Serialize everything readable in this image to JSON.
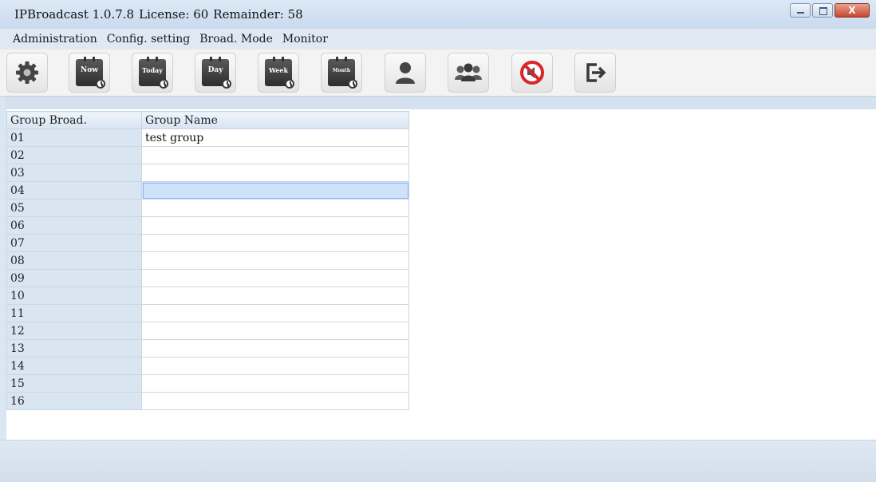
{
  "window": {
    "title_app": "IPBroadcast 1.0.7.8",
    "title_license": "License: 60",
    "title_remainder": "Remainder: 58",
    "close_label": "X"
  },
  "menu": [
    "Administration",
    "Config. setting",
    "Broad. Mode",
    "Monitor"
  ],
  "toolbar": {
    "buttons": [
      {
        "icon": "gear-icon"
      },
      {
        "icon": "calendar-now-icon",
        "label": "Now"
      },
      {
        "icon": "calendar-today-icon",
        "label": "Today"
      },
      {
        "icon": "calendar-day-icon",
        "label": "Day"
      },
      {
        "icon": "calendar-week-icon",
        "label": "Week"
      },
      {
        "icon": "calendar-month-icon",
        "label": "Month"
      },
      {
        "icon": "user-icon"
      },
      {
        "icon": "group-icon"
      },
      {
        "icon": "mute-icon"
      },
      {
        "icon": "exit-icon"
      }
    ]
  },
  "table": {
    "headers": [
      "Group Broad.",
      "Group Name"
    ],
    "rows": [
      {
        "num": "01",
        "name": "test group"
      },
      {
        "num": "02",
        "name": ""
      },
      {
        "num": "03",
        "name": ""
      },
      {
        "num": "04",
        "name": ""
      },
      {
        "num": "05",
        "name": ""
      },
      {
        "num": "06",
        "name": ""
      },
      {
        "num": "07",
        "name": ""
      },
      {
        "num": "08",
        "name": ""
      },
      {
        "num": "09",
        "name": ""
      },
      {
        "num": "10",
        "name": ""
      },
      {
        "num": "11",
        "name": ""
      },
      {
        "num": "12",
        "name": ""
      },
      {
        "num": "13",
        "name": ""
      },
      {
        "num": "14",
        "name": ""
      },
      {
        "num": "15",
        "name": ""
      },
      {
        "num": "16",
        "name": ""
      }
    ],
    "selected_row": "04"
  },
  "colors": {
    "mute_red": "#d8262c",
    "icon_dark": "#3a3a3a",
    "selection": "#cfe2fb"
  }
}
